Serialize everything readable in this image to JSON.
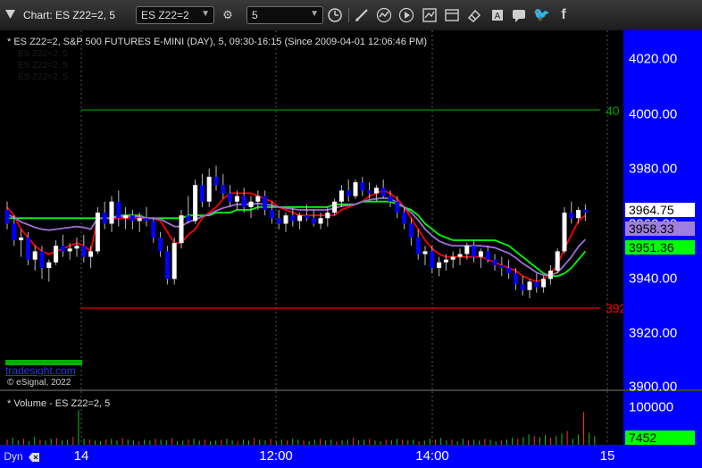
{
  "window": {
    "title": "Chart: ES Z22=2, 5",
    "symbol_value": "ES Z22=2",
    "interval_value": "5"
  },
  "toolbar": {
    "icons": [
      "symbol-link-icon",
      "settings-icon",
      "interval-link-icon",
      "draw-tool-icon",
      "line-tool-icon",
      "replay-icon",
      "studies-icon",
      "layout-icon",
      "eraser-icon",
      "text-icon",
      "comment-icon",
      "twitter-icon",
      "facebook-icon"
    ]
  },
  "chart": {
    "header": "* ES Z22=2, S&P 500 FUTURES E-MINI (DAY), 5, 09:30-16:15 (Since 2009-04-01 12:06:46 PM)",
    "legend_lines": [
      "ES Z22=2, 5",
      "ES Z22=2, 5",
      "ES Z22=2, 5"
    ],
    "watermark": "tradesight.com",
    "copyright": "© eSignal, 2022",
    "level_green_label": "40",
    "level_red_label": "392",
    "colors": {
      "up": "#ffffff",
      "down": "#0000ff",
      "red": "#ff0000",
      "green": "#00ff00",
      "purple": "#9b6fd6",
      "axis": "#0000ff"
    }
  },
  "price_axis": {
    "ticks": [
      "4020.00",
      "4000.00",
      "3980.00",
      "3960.00",
      "3940.00",
      "3920.00",
      "3900.00"
    ],
    "tags": [
      {
        "text": "3964.75",
        "bg": "#ffffff"
      },
      {
        "text": "3958.33",
        "bg": "#a07ee0"
      },
      {
        "text": "3951.36",
        "bg": "#00ff00"
      }
    ]
  },
  "volume": {
    "header": "* Volume - ES Z22=2, 5",
    "tick": "100000",
    "current": "7452",
    "bars": [
      6,
      8,
      5,
      7,
      4,
      9,
      6,
      5,
      7,
      8,
      5,
      6,
      9,
      40,
      7,
      6,
      5,
      4,
      6,
      7,
      5,
      8,
      6,
      5,
      4,
      6,
      5,
      7,
      6,
      5,
      8,
      4,
      5,
      6,
      7,
      5,
      6,
      4,
      5,
      6,
      7,
      5,
      4,
      6,
      5,
      8,
      6,
      5,
      7,
      4,
      6,
      5,
      7,
      6,
      5,
      4,
      6,
      7,
      5,
      6,
      4,
      5,
      6,
      8,
      5,
      6,
      7,
      5,
      4,
      6,
      5,
      7,
      6,
      5,
      6,
      4,
      5,
      7,
      6,
      8,
      5,
      6,
      4,
      7,
      5,
      6,
      5,
      7,
      6,
      4,
      5,
      6,
      8,
      7,
      9,
      12,
      10,
      9,
      11,
      8,
      10,
      13,
      16,
      7,
      12,
      38,
      14,
      10
    ]
  },
  "time_axis": {
    "labels": [
      {
        "text": "Dyn"
      },
      {
        "text": "14"
      },
      {
        "text": "12:00"
      },
      {
        "text": "14:00"
      },
      {
        "text": "15"
      }
    ]
  },
  "chart_data": {
    "type": "candlestick",
    "symbol": "ES Z22=2",
    "interval": "5",
    "ylim": [
      3900,
      4030
    ],
    "levels": [
      {
        "value": 4001.2,
        "color": "#00a000"
      },
      {
        "value": 3929.4,
        "color": "#ff0000"
      }
    ],
    "candles": [
      [
        3965,
        3968,
        3958,
        3960
      ],
      [
        3960,
        3963,
        3952,
        3954
      ],
      [
        3954,
        3958,
        3948,
        3955
      ],
      [
        3955,
        3957,
        3945,
        3947
      ],
      [
        3947,
        3952,
        3943,
        3950
      ],
      [
        3950,
        3952,
        3940,
        3944
      ],
      [
        3944,
        3947,
        3939,
        3946
      ],
      [
        3946,
        3954,
        3945,
        3952
      ],
      [
        3952,
        3956,
        3948,
        3950
      ],
      [
        3950,
        3953,
        3947,
        3951
      ],
      [
        3951,
        3955,
        3948,
        3952
      ],
      [
        3952,
        3956,
        3946,
        3948
      ],
      [
        3948,
        3952,
        3944,
        3950
      ],
      [
        3950,
        3966,
        3949,
        3964
      ],
      [
        3964,
        3968,
        3958,
        3960
      ],
      [
        3960,
        3970,
        3957,
        3968
      ],
      [
        3968,
        3972,
        3959,
        3962
      ],
      [
        3962,
        3966,
        3958,
        3963
      ],
      [
        3963,
        3965,
        3958,
        3961
      ],
      [
        3961,
        3964,
        3957,
        3962
      ],
      [
        3962,
        3966,
        3959,
        3961
      ],
      [
        3961,
        3962,
        3953,
        3955
      ],
      [
        3955,
        3957,
        3948,
        3950
      ],
      [
        3950,
        3952,
        3938,
        3940
      ],
      [
        3940,
        3955,
        3938,
        3953
      ],
      [
        3953,
        3965,
        3951,
        3963
      ],
      [
        3963,
        3970,
        3960,
        3961
      ],
      [
        3961,
        3976,
        3960,
        3974
      ],
      [
        3974,
        3978,
        3966,
        3968
      ],
      [
        3968,
        3980,
        3966,
        3977
      ],
      [
        3977,
        3981,
        3972,
        3974
      ],
      [
        3974,
        3978,
        3969,
        3971
      ],
      [
        3971,
        3974,
        3966,
        3968
      ],
      [
        3968,
        3972,
        3965,
        3970
      ],
      [
        3970,
        3973,
        3964,
        3966
      ],
      [
        3966,
        3970,
        3962,
        3968
      ],
      [
        3968,
        3972,
        3965,
        3970
      ],
      [
        3970,
        3972,
        3963,
        3965
      ],
      [
        3965,
        3968,
        3960,
        3962
      ],
      [
        3962,
        3965,
        3958,
        3960
      ],
      [
        3960,
        3964,
        3957,
        3963
      ],
      [
        3963,
        3966,
        3959,
        3961
      ],
      [
        3961,
        3964,
        3958,
        3963
      ],
      [
        3963,
        3967,
        3961,
        3962
      ],
      [
        3962,
        3965,
        3959,
        3960
      ],
      [
        3960,
        3964,
        3958,
        3962
      ],
      [
        3962,
        3966,
        3959,
        3964
      ],
      [
        3964,
        3969,
        3963,
        3968
      ],
      [
        3968,
        3974,
        3966,
        3972
      ],
      [
        3972,
        3976,
        3968,
        3970
      ],
      [
        3970,
        3976,
        3969,
        3975
      ],
      [
        3975,
        3977,
        3970,
        3972
      ],
      [
        3972,
        3975,
        3969,
        3971
      ],
      [
        3971,
        3974,
        3968,
        3973
      ],
      [
        3973,
        3976,
        3969,
        3970
      ],
      [
        3970,
        3972,
        3966,
        3968
      ],
      [
        3968,
        3970,
        3962,
        3964
      ],
      [
        3964,
        3966,
        3958,
        3960
      ],
      [
        3960,
        3962,
        3952,
        3955
      ],
      [
        3955,
        3958,
        3947,
        3949
      ],
      [
        3949,
        3952,
        3945,
        3950
      ],
      [
        3950,
        3952,
        3942,
        3944
      ],
      [
        3944,
        3948,
        3941,
        3946
      ],
      [
        3946,
        3949,
        3943,
        3947
      ],
      [
        3947,
        3950,
        3944,
        3948
      ],
      [
        3948,
        3951,
        3945,
        3949
      ],
      [
        3949,
        3953,
        3947,
        3952
      ],
      [
        3952,
        3954,
        3946,
        3948
      ],
      [
        3948,
        3951,
        3944,
        3950
      ],
      [
        3950,
        3952,
        3946,
        3947
      ],
      [
        3947,
        3949,
        3943,
        3945
      ],
      [
        3945,
        3948,
        3941,
        3944
      ],
      [
        3944,
        3947,
        3940,
        3942
      ],
      [
        3942,
        3944,
        3936,
        3938
      ],
      [
        3938,
        3941,
        3934,
        3936
      ],
      [
        3936,
        3940,
        3933,
        3939
      ],
      [
        3939,
        3942,
        3935,
        3937
      ],
      [
        3937,
        3941,
        3935,
        3940
      ],
      [
        3940,
        3945,
        3938,
        3943
      ],
      [
        3943,
        3951,
        3942,
        3950
      ],
      [
        3950,
        3966,
        3949,
        3964
      ],
      [
        3964,
        3968,
        3960,
        3962
      ],
      [
        3962,
        3966,
        3960,
        3965
      ],
      [
        3965,
        3967,
        3961,
        3964
      ]
    ],
    "red_line": [
      3966,
      3963,
      3958,
      3955,
      3952,
      3950,
      3949,
      3950,
      3951,
      3952,
      3953,
      3952,
      3950,
      3962,
      3962,
      3962,
      3962,
      3962,
      3962,
      3962,
      3962,
      3962,
      3961,
      3957,
      3953,
      3953,
      3956,
      3958,
      3962,
      3964,
      3966,
      3969,
      3971,
      3971,
      3971,
      3971,
      3970,
      3969,
      3968,
      3966,
      3965,
      3964,
      3963,
      3963,
      3963,
      3963,
      3963,
      3963,
      3965,
      3966,
      3967,
      3968,
      3970,
      3971,
      3972,
      3971,
      3969,
      3966,
      3962,
      3958,
      3954,
      3951,
      3949,
      3948,
      3948,
      3948,
      3948,
      3948,
      3948,
      3947,
      3946,
      3945,
      3944,
      3943,
      3941,
      3940,
      3939,
      3940,
      3942,
      3945,
      3951,
      3956,
      3961,
      3963
    ],
    "green_line": [
      3962,
      3962,
      3962,
      3962,
      3962,
      3962,
      3962,
      3962,
      3962,
      3962,
      3962,
      3962,
      3962,
      3962,
      3962,
      3962,
      3963,
      3963,
      3963,
      3963,
      3962,
      3962,
      3962,
      3962,
      3962,
      3962,
      3963,
      3963,
      3963,
      3963,
      3964,
      3964,
      3964,
      3965,
      3965,
      3965,
      3966,
      3966,
      3966,
      3966,
      3966,
      3966,
      3966,
      3966,
      3966,
      3966,
      3966,
      3967,
      3967,
      3967,
      3967,
      3968,
      3968,
      3968,
      3968,
      3968,
      3967,
      3966,
      3965,
      3963,
      3960,
      3958,
      3956,
      3955,
      3954,
      3954,
      3954,
      3954,
      3954,
      3954,
      3954,
      3953,
      3952,
      3950,
      3948,
      3946,
      3944,
      3942,
      3941,
      3941,
      3942,
      3944,
      3947,
      3950
    ]
  }
}
